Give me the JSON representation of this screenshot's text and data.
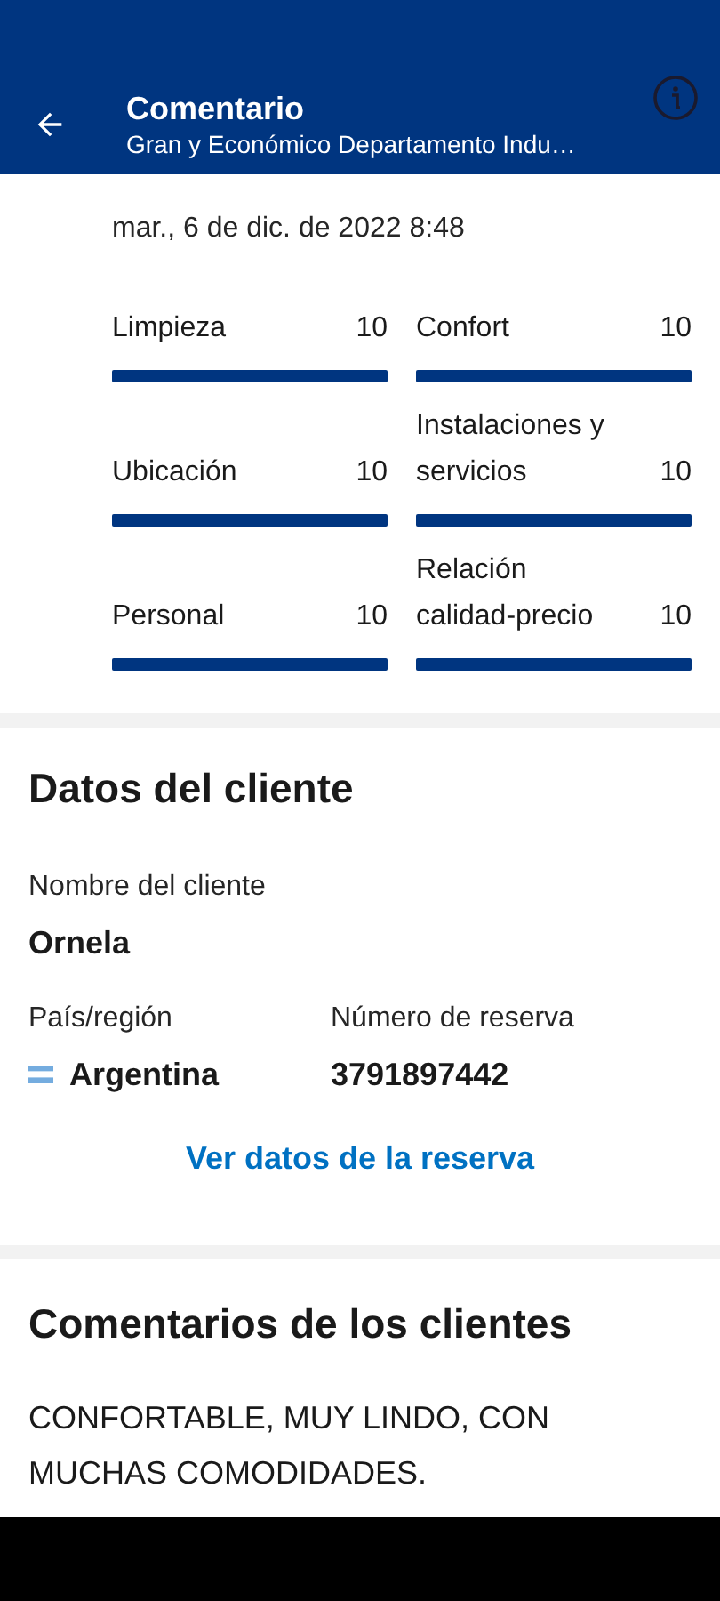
{
  "header": {
    "title": "Comentario",
    "subtitle": "Gran y Económico Departamento Indu…"
  },
  "review": {
    "date": "mar., 6 de dic. de 2022 8:48",
    "ratings": [
      {
        "label": "Limpieza",
        "score": "10",
        "level": 1
      },
      {
        "label": "Ubicación",
        "score": "10",
        "level": 1
      },
      {
        "label": "Personal",
        "score": "10",
        "level": 1
      },
      {
        "label": "Confort",
        "score": "10",
        "level": 1
      },
      {
        "label": "Instalaciones y servicios",
        "score": "10",
        "level": 1
      },
      {
        "label": "Relación calidad-precio",
        "score": "10",
        "level": 1
      }
    ]
  },
  "client": {
    "heading": "Datos del cliente",
    "name_label": "Nombre del cliente",
    "name": "Ornela",
    "country_label": "País/región",
    "country": "Argentina",
    "booking_label": "Número de reserva",
    "booking": "3791897442",
    "link": "Ver datos de la reserva"
  },
  "comments": {
    "heading": "Comentarios de los clientes",
    "text": "CONFORTABLE, MUY LINDO, CON MUCHAS COMODIDADES."
  }
}
